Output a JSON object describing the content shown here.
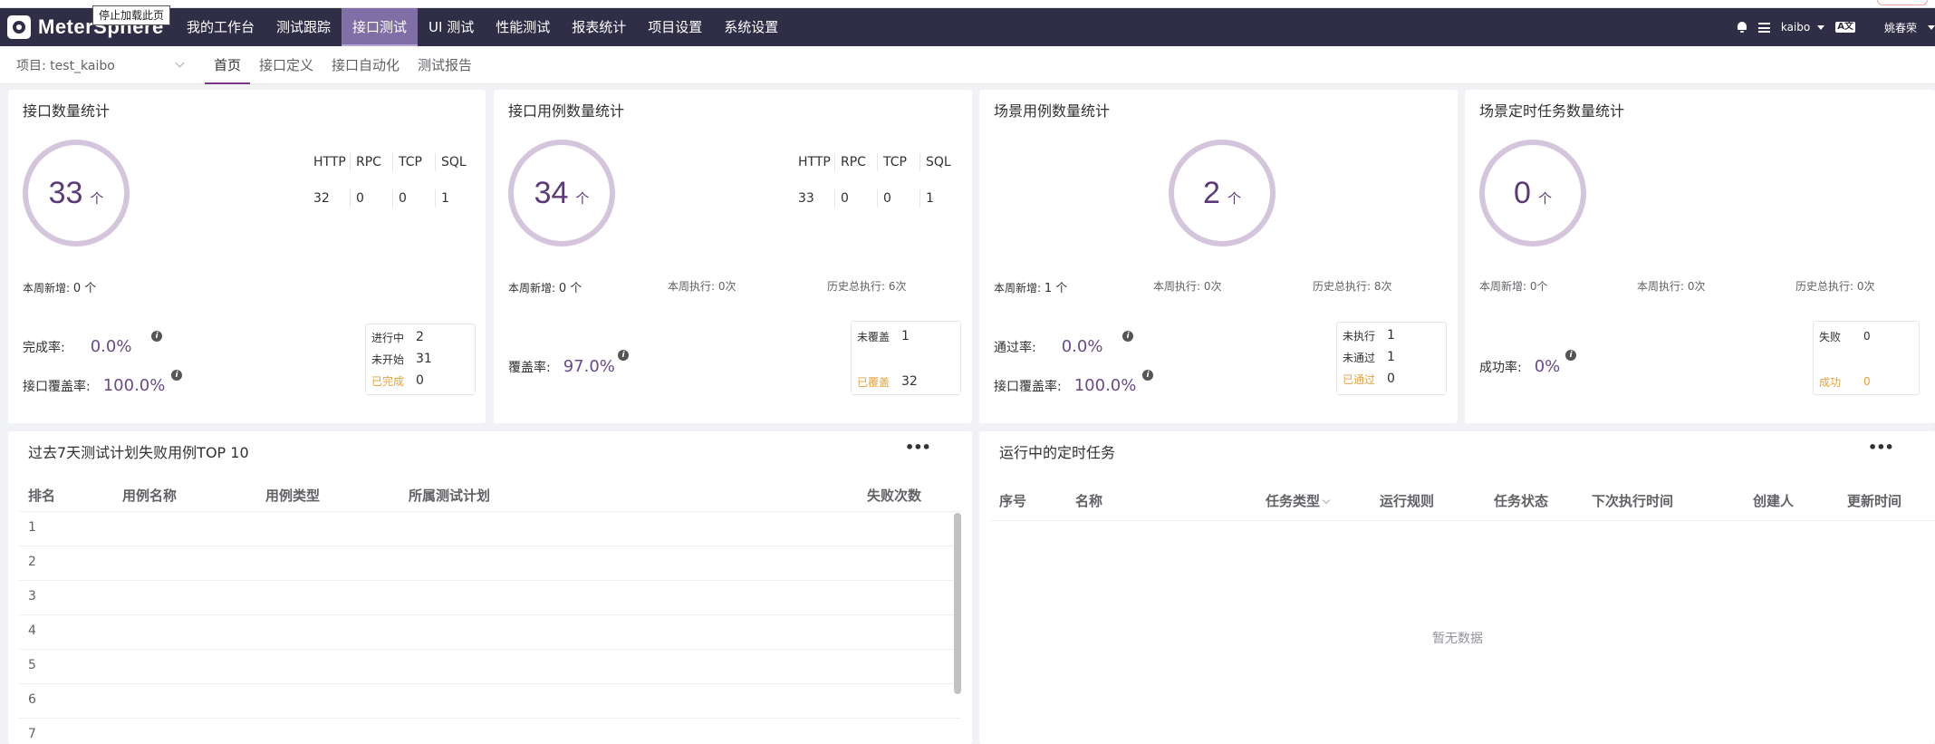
{
  "tooltip": "停止加载此页",
  "brand": "MeterSphere",
  "nav": {
    "items": [
      "我的工作台",
      "测试跟踪",
      "接口测试",
      "UI 测试",
      "性能测试",
      "报表统计",
      "项目设置",
      "系统设置"
    ],
    "user": "kaibo",
    "lang": "A̲",
    "user2": "姚春荣"
  },
  "subnav": {
    "project": "项目: test_kaibo",
    "tabs": [
      "首页",
      "接口定义",
      "接口自动化",
      "测试报告"
    ]
  },
  "cards": {
    "api": {
      "title": "接口数量统计",
      "count": "33",
      "unit": "个",
      "proto_headers": [
        "HTTP",
        "RPC",
        "TCP",
        "SQL"
      ],
      "proto_values": [
        "32",
        "0",
        "0",
        "1"
      ],
      "week_new": "本周新增: ",
      "week_new_val": "0 个",
      "rate1_label": "完成率:",
      "rate1_val": "0.0%",
      "rate2_label": "接口覆盖率:",
      "rate2_val": "100.0%",
      "status": [
        {
          "label": "进行中",
          "value": "2"
        },
        {
          "label": "未开始",
          "value": "31"
        },
        {
          "label": "已完成",
          "value": "0"
        }
      ]
    },
    "case": {
      "title": "接口用例数量统计",
      "count": "34",
      "unit": "个",
      "proto_headers": [
        "HTTP",
        "RPC",
        "TCP",
        "SQL"
      ],
      "proto_values": [
        "33",
        "0",
        "0",
        "1"
      ],
      "week_new": "本周新增: ",
      "week_new_val": "0 个",
      "week_exec": "本周执行: 0次",
      "history_exec": "历史总执行: 6次",
      "rate_label": "覆盖率:",
      "rate_val": "97.0%",
      "status": [
        {
          "label": "未覆盖",
          "value": "1"
        },
        {
          "label": "已覆盖",
          "value": "32"
        }
      ]
    },
    "scenario": {
      "title": "场景用例数量统计",
      "count": "2",
      "unit": "个",
      "week_new": "本周新增: ",
      "week_new_val": "1 个",
      "week_exec": "本周执行: 0次",
      "history_exec": "历史总执行: 8次",
      "rate1_label": "通过率:",
      "rate1_val": "0.0%",
      "rate2_label": "接口覆盖率:",
      "rate2_val": "100.0%",
      "status": [
        {
          "label": "未执行",
          "value": "1"
        },
        {
          "label": "未通过",
          "value": "1"
        },
        {
          "label": "已通过",
          "value": "0"
        }
      ]
    },
    "schedule": {
      "title": "场景定时任务数量统计",
      "count": "0",
      "unit": "个",
      "week_new": "本周新增: 0个",
      "week_exec": "本周执行: 0次",
      "history_exec": "历史总执行: 0次",
      "rate_label": "成功率:",
      "rate_val": "0%",
      "status": [
        {
          "label": "失败",
          "value": "0"
        },
        {
          "label": "成功",
          "value": "0"
        }
      ]
    }
  },
  "failure": {
    "title": "过去7天测试计划失败用例TOP 10",
    "more": "•••",
    "headers": [
      "排名",
      "用例名称",
      "用例类型",
      "所属测试计划",
      "失败次数"
    ],
    "rows": [
      "1",
      "2",
      "3",
      "4",
      "5",
      "6",
      "7"
    ]
  },
  "tasks": {
    "title": "运行中的定时任务",
    "more": "•••",
    "headers": [
      "序号",
      "名称",
      "任务类型",
      "运行规则",
      "任务状态",
      "下次执行时间",
      "创建人",
      "更新时间"
    ],
    "empty": "暂无数据"
  }
}
